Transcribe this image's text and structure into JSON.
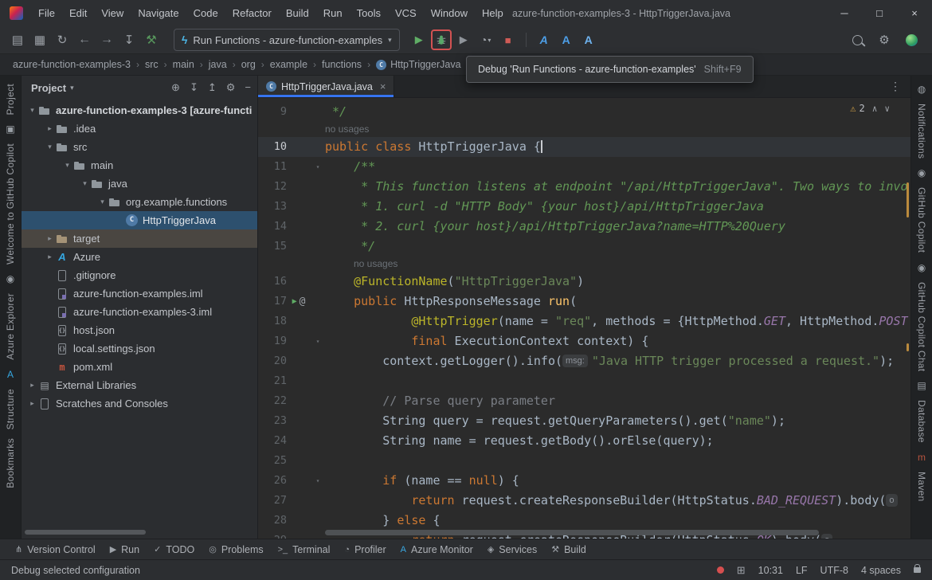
{
  "window": {
    "title": "azure-function-examples-3 - HttpTriggerJava.java",
    "menus": [
      "File",
      "Edit",
      "View",
      "Navigate",
      "Code",
      "Refactor",
      "Build",
      "Run",
      "Tools",
      "VCS",
      "Window",
      "Help"
    ]
  },
  "toolbar": {
    "run_config_label": "Run Functions - azure-function-examples",
    "tooltip_text": "Debug 'Run Functions - azure-function-examples'",
    "tooltip_shortcut": "Shift+F9"
  },
  "breadcrumbs": [
    "azure-function-examples-3",
    "src",
    "main",
    "java",
    "org",
    "example",
    "functions",
    "HttpTriggerJava"
  ],
  "project": {
    "header": "Project",
    "actions": [
      {
        "name": "select-opened-file-icon",
        "g": "⊕"
      },
      {
        "name": "expand-all-icon",
        "g": "↧"
      },
      {
        "name": "collapse-all-icon",
        "g": "↥"
      },
      {
        "name": "settings-icon",
        "g": "⚙"
      },
      {
        "name": "hide-panel-icon",
        "g": "−"
      }
    ],
    "items": [
      {
        "level": 0,
        "arrow": "▾",
        "icon": "folder",
        "label": "azure-function-examples-3 [azure-functi",
        "bold": true
      },
      {
        "level": 1,
        "arrow": "▸",
        "icon": "folder",
        "label": ".idea"
      },
      {
        "level": 1,
        "arrow": "▾",
        "icon": "folder",
        "label": "src"
      },
      {
        "level": 2,
        "arrow": "▾",
        "icon": "folder",
        "label": "main"
      },
      {
        "level": 3,
        "arrow": "▾",
        "icon": "folder",
        "label": "java"
      },
      {
        "level": 4,
        "arrow": "▾",
        "icon": "package",
        "label": "org.example.functions"
      },
      {
        "level": 5,
        "arrow": "",
        "icon": "class",
        "label": "HttpTriggerJava",
        "selected": true
      },
      {
        "level": 1,
        "arrow": "▸",
        "icon": "folder-target",
        "label": "target",
        "hover": true
      },
      {
        "level": 1,
        "arrow": "▸",
        "icon": "azure",
        "label": "Azure"
      },
      {
        "level": 1,
        "arrow": "",
        "icon": "file",
        "label": ".gitignore"
      },
      {
        "level": 1,
        "arrow": "",
        "icon": "module",
        "label": "azure-function-examples.iml"
      },
      {
        "level": 1,
        "arrow": "",
        "icon": "module",
        "label": "azure-function-examples-3.iml"
      },
      {
        "level": 1,
        "arrow": "",
        "icon": "json",
        "label": "host.json"
      },
      {
        "level": 1,
        "arrow": "",
        "icon": "json",
        "label": "local.settings.json"
      },
      {
        "level": 1,
        "arrow": "",
        "icon": "maven",
        "label": "pom.xml"
      },
      {
        "level": 0,
        "arrow": "▸",
        "icon": "lib",
        "label": "External Libraries"
      },
      {
        "level": 0,
        "arrow": "▸",
        "icon": "scratch",
        "label": "Scratches and Consoles"
      }
    ]
  },
  "editor": {
    "tab_label": "HttpTriggerJava.java",
    "warning_count": "2",
    "lines": [
      {
        "n": "9",
        "t": [
          [
            "c",
            " */"
          ]
        ]
      },
      {
        "hint": "no usages",
        "pad": 0
      },
      {
        "n": "10",
        "active": true,
        "caret": true,
        "t": [
          [
            "k",
            "public class"
          ],
          [
            "d",
            " HttpTriggerJava {"
          ]
        ]
      },
      {
        "n": "11",
        "fold": true,
        "t": [
          [
            "c",
            "    /**"
          ]
        ]
      },
      {
        "n": "12",
        "t": [
          [
            "c",
            "     * This function listens at endpoint \"/api/HttpTriggerJava\". Two ways to invo"
          ]
        ]
      },
      {
        "n": "13",
        "t": [
          [
            "c",
            "     * 1. curl -d \"HTTP Body\" {your host}/api/HttpTriggerJava"
          ]
        ]
      },
      {
        "n": "14",
        "t": [
          [
            "c",
            "     * 2. curl {your host}/api/HttpTriggerJava?name=HTTP%20Query"
          ]
        ]
      },
      {
        "n": "15",
        "t": [
          [
            "c",
            "     */"
          ]
        ]
      },
      {
        "hint": "no usages",
        "pad": 4
      },
      {
        "n": "16",
        "t": [
          [
            "d",
            "    "
          ],
          [
            "a",
            "@FunctionName"
          ],
          [
            "d",
            "("
          ],
          [
            "s",
            "\"HttpTriggerJava\""
          ],
          [
            "d",
            ")"
          ]
        ]
      },
      {
        "n": "17",
        "run": true,
        "t": [
          [
            "d",
            "    "
          ],
          [
            "k",
            "public"
          ],
          [
            "d",
            " HttpResponseMessage "
          ],
          [
            "m",
            "run"
          ],
          [
            "d",
            "("
          ]
        ]
      },
      {
        "n": "18",
        "t": [
          [
            "d",
            "            "
          ],
          [
            "a",
            "@HttpTrigger"
          ],
          [
            "d",
            "(name = "
          ],
          [
            "s",
            "\"req\""
          ],
          [
            "d",
            ", methods = {HttpMethod."
          ],
          [
            "cn",
            "GET"
          ],
          [
            "d",
            ", HttpMethod."
          ],
          [
            "cn",
            "POST"
          ]
        ]
      },
      {
        "n": "19",
        "fold": true,
        "t": [
          [
            "d",
            "            "
          ],
          [
            "k",
            "final"
          ],
          [
            "d",
            " ExecutionContext context) {"
          ]
        ]
      },
      {
        "n": "20",
        "t": [
          [
            "d",
            "        context.getLogger().info("
          ],
          [
            "il",
            "msg:"
          ],
          [
            "s",
            "\"Java HTTP trigger processed a request.\""
          ],
          [
            "d",
            ");"
          ]
        ]
      },
      {
        "n": "21",
        "t": []
      },
      {
        "n": "22",
        "t": [
          [
            "lc",
            "        // Parse query parameter"
          ]
        ]
      },
      {
        "n": "23",
        "t": [
          [
            "d",
            "        String query = request.getQueryParameters().get("
          ],
          [
            "s",
            "\"name\""
          ],
          [
            "d",
            ");"
          ]
        ]
      },
      {
        "n": "24",
        "t": [
          [
            "d",
            "        String name = request.getBody().orElse(query);"
          ]
        ]
      },
      {
        "n": "25",
        "t": []
      },
      {
        "n": "26",
        "fold": true,
        "t": [
          [
            "d",
            "        "
          ],
          [
            "k",
            "if"
          ],
          [
            "d",
            " (name == "
          ],
          [
            "k",
            "null"
          ],
          [
            "d",
            ") {"
          ]
        ]
      },
      {
        "n": "27",
        "t": [
          [
            "d",
            "            "
          ],
          [
            "k",
            "return"
          ],
          [
            "d",
            " request.createResponseBuilder(HttpStatus."
          ],
          [
            "cn",
            "BAD_REQUEST"
          ],
          [
            "d",
            ").body("
          ],
          [
            "il",
            "o"
          ]
        ]
      },
      {
        "n": "28",
        "t": [
          [
            "d",
            "        } "
          ],
          [
            "k",
            "else"
          ],
          [
            "d",
            " {"
          ]
        ]
      },
      {
        "n": "29",
        "t": [
          [
            "d",
            "            "
          ],
          [
            "k",
            "return"
          ],
          [
            "d",
            " request.createResponseBuilder(HttpStatus."
          ],
          [
            "cn",
            "OK"
          ],
          [
            "d",
            ").body("
          ],
          [
            "il",
            "o"
          ]
        ]
      }
    ]
  },
  "stripes": {
    "left": [
      {
        "t": "text",
        "label": "Project"
      },
      {
        "t": "icon",
        "name": "commit-window-icon",
        "glyph": "▣"
      },
      {
        "t": "text",
        "label": "Welcome to GitHub Copilot"
      },
      {
        "t": "icon",
        "name": "github-copilot-icon",
        "glyph": "◉"
      },
      {
        "t": "text",
        "label": "Azure Explorer"
      },
      {
        "t": "icon",
        "name": "azure-explorer-icon",
        "glyph": "A",
        "color": "#35a7e0"
      },
      {
        "t": "text",
        "label": "Structure"
      },
      {
        "t": "text",
        "label": "Bookmarks"
      }
    ],
    "right": [
      {
        "t": "icon",
        "name": "notifications-bell-icon",
        "glyph": "◍"
      },
      {
        "t": "text",
        "label": "Notifications"
      },
      {
        "t": "icon",
        "name": "github-copilot-icon",
        "glyph": "◉"
      },
      {
        "t": "text",
        "label": "GitHub Copilot"
      },
      {
        "t": "icon",
        "name": "copilot-chat-icon",
        "glyph": "◉"
      },
      {
        "t": "text",
        "label": "GitHub Copilot Chat"
      },
      {
        "t": "icon",
        "name": "database-icon",
        "glyph": "▤"
      },
      {
        "t": "text",
        "label": "Database"
      },
      {
        "t": "icon",
        "name": "maven-icon",
        "glyph": "m",
        "color": "#b8543f"
      },
      {
        "t": "text",
        "label": "Maven"
      }
    ]
  },
  "bottom_bar": [
    {
      "label": "Version Control",
      "glyph": "⋔"
    },
    {
      "label": "Run",
      "glyph": "▶"
    },
    {
      "label": "TODO",
      "glyph": "✓"
    },
    {
      "label": "Problems",
      "glyph": "◎"
    },
    {
      "label": "Terminal",
      "glyph": ">_"
    },
    {
      "label": "Profiler",
      "glyph": "◔"
    },
    {
      "label": "Azure Monitor",
      "glyph": "A",
      "color": "#3aa7e0"
    },
    {
      "label": "Services",
      "glyph": "◈"
    },
    {
      "label": "Build",
      "glyph": "⚒"
    }
  ],
  "status": {
    "left": "Debug selected configuration",
    "position": "10:31",
    "line_sep": "LF",
    "encoding": "UTF-8",
    "indent": "4 spaces"
  },
  "glyphs": {
    "open": "▤",
    "save": "▦",
    "sync": "↻",
    "back": "←",
    "forward": "→",
    "tool": "↧",
    "hammer": "⚒",
    "func": "ϟ",
    "combo_arrow": "▾",
    "run": "▶",
    "coverage": "▶",
    "profiler": "◔",
    "stop": "■",
    "a": "A",
    "gear": "⚙",
    "warn": "⚠",
    "up": "∧",
    "down": "∨",
    "dots": "⋮",
    "close": "×",
    "sep": "›",
    "min": "─",
    "max": "□",
    "grid": "⊞"
  },
  "colors": {
    "accent_blue": "#3674f0",
    "tree_selection": "#2d506e",
    "debug_highlight": "#d25252",
    "run_green": "#5fad65",
    "stop_red": "#cf5b56",
    "warning_yellow": "#d9a748",
    "azure_blue": "#35a7e0"
  }
}
